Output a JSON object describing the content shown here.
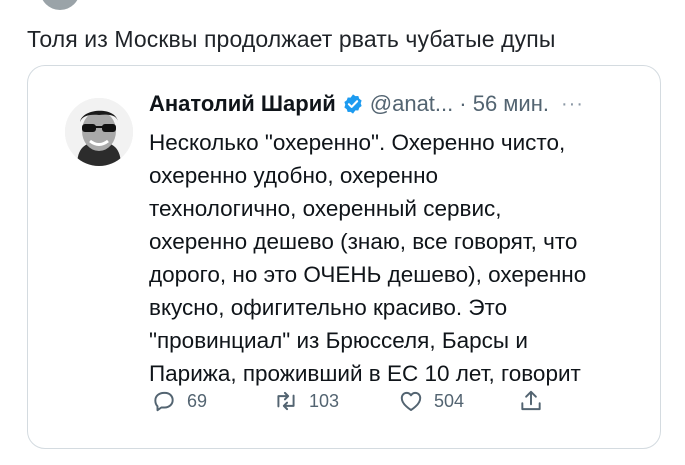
{
  "post": {
    "text": "Толя из Москвы продолжает рвать чубатые дупы"
  },
  "quoted_tweet": {
    "author_name": "Анатолий Шарий",
    "verified": true,
    "handle": "@anat...",
    "timestamp": "· 56 мин.",
    "more": "···",
    "text_lines": [
      "Несколько \"охеренно\". Охеренно чисто,",
      "охеренно удобно, охеренно",
      "технологично, охеренный сервис,",
      "охеренно дешево (знаю, все говорят, что",
      "дорого, но это ОЧЕНЬ дешево), охеренно",
      "вкусно, офигительно красиво. Это",
      "\"провинциал\" из Брюсселя, Барсы и",
      "Парижа, проживший в ЕС 10 лет, говорит"
    ],
    "actions": {
      "replies": "69",
      "retweets": "103",
      "likes": "504"
    },
    "icons": {
      "reply": "reply-icon",
      "retweet": "retweet-icon",
      "like": "heart-icon",
      "share": "share-icon",
      "verified": "verified-badge-icon"
    },
    "colors": {
      "verified_blue": "#1d9bf0",
      "muted_text": "#536471"
    }
  }
}
